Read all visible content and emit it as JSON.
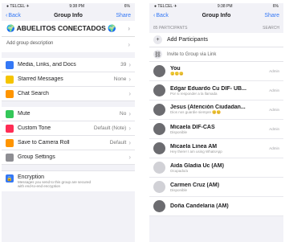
{
  "left": {
    "status": {
      "carrier": "● TELCEL ✈",
      "time": "9:38 PM",
      "battery": "6%"
    },
    "nav": {
      "back": "Back",
      "title": "Group Info",
      "share": "Share"
    },
    "group_name": "ABUELITOS CONECTADOS",
    "description_placeholder": "Add group description",
    "rows": [
      {
        "label": "Media, Links, and Docs",
        "value": "39",
        "icon_color": "#3478f6",
        "icon": "media-icon"
      },
      {
        "label": "Starred Messages",
        "value": "None",
        "icon_color": "#f5c400",
        "icon": "star-icon"
      },
      {
        "label": "Chat Search",
        "value": "",
        "icon_color": "#ff9500",
        "icon": "search-icon"
      }
    ],
    "rows2": [
      {
        "label": "Mute",
        "value": "No",
        "icon_color": "#34c759",
        "icon": "speaker-icon"
      },
      {
        "label": "Custom Tone",
        "value": "Default (Note)",
        "icon_color": "#ff2d55",
        "icon": "tone-icon"
      },
      {
        "label": "Save to Camera Roll",
        "value": "Default",
        "icon_color": "#ff9500",
        "icon": "download-icon"
      },
      {
        "label": "Group Settings",
        "value": "",
        "icon_color": "#8e8e93",
        "icon": "gear-icon"
      }
    ],
    "encryption": {
      "title": "Encryption",
      "line1": "Messages you send to this group are secured",
      "line2": "with end-to-end encryption"
    }
  },
  "right": {
    "status": {
      "carrier": "● TELCEL ✈",
      "time": "9:38 PM",
      "battery": "6%"
    },
    "nav": {
      "back": "Back",
      "title": "Group Info",
      "share": "Share"
    },
    "section_header": "85 PARTICIPANTS",
    "search_label": "SEARCH",
    "add_participants": "Add Participants",
    "invite_link": "Invite to Group via Link",
    "members": [
      {
        "name": "You",
        "status": "🙂🙂😊",
        "admin": "Admin",
        "light": false
      },
      {
        "name": "Edgar Eduardo Cu DIF- UB...",
        "status": "Por si responder a la llamada",
        "admin": "Admin",
        "light": false
      },
      {
        "name": "Jesus (Atención Ciudadan...",
        "status": "Dios nos guardie siempre 😊😊",
        "admin": "Admin",
        "light": false
      },
      {
        "name": "Micaela DIF-CAS",
        "status": "Disponible",
        "admin": "Admin",
        "light": false
      },
      {
        "name": "Micaela Linea AM",
        "status": "Hey there! I am using WhatsApp",
        "admin": "Admin",
        "light": false
      },
      {
        "name": "Aida Gladia Uc (AM)",
        "status": "Ocupado/a",
        "admin": "",
        "light": true
      },
      {
        "name": "Carmen Cruz (AM)",
        "status": "Disponible",
        "admin": "",
        "light": true
      },
      {
        "name": "Doña Candelaria (AM)",
        "status": "",
        "admin": "",
        "light": false
      }
    ]
  }
}
